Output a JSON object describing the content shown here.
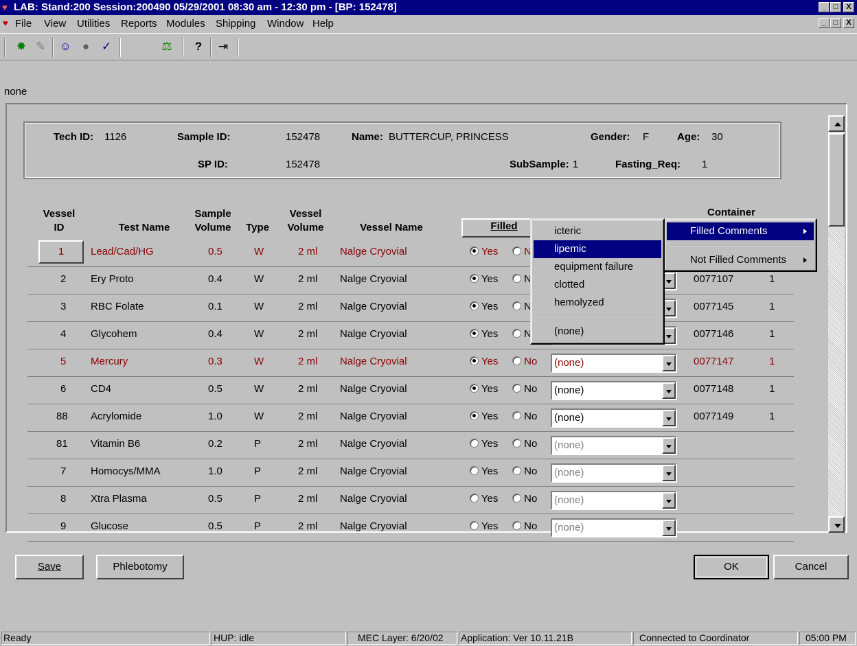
{
  "window": {
    "title": "LAB: Stand:200 Session:200490 05/29/2001 08:30 am - 12:30 pm - [BP: 152478]",
    "controls": [
      "_",
      "□",
      "X"
    ]
  },
  "menubar": {
    "items": [
      {
        "label": "File"
      },
      {
        "label": "View"
      },
      {
        "label": "Utilities"
      },
      {
        "label": "Reports"
      },
      {
        "label": "Modules"
      },
      {
        "label": "Shipping"
      },
      {
        "label": "Window"
      },
      {
        "label": "Help"
      }
    ]
  },
  "toolbar": {
    "icons": [
      "new-icon",
      "edit-icon",
      "people-icon",
      "record-icon",
      "checkmark-icon",
      "scale-icon",
      "help-icon",
      "exit-icon"
    ],
    "glyphs": [
      "✸",
      "✎",
      "☺",
      "●",
      "✓",
      "⚖",
      "?",
      "⇥"
    ]
  },
  "status_line": "none",
  "info": {
    "tech_id_label": "Tech ID:",
    "tech_id": "1126",
    "sample_id_label": "Sample ID:",
    "sample_id": "152478",
    "name_label": "Name:",
    "name": "BUTTERCUP, PRINCESS",
    "gender_label": "Gender:",
    "gender": "F",
    "age_label": "Age:",
    "age": "30",
    "sp_id_label": "SP ID:",
    "sp_id": "152478",
    "subsample_label": "SubSample:",
    "subsample": "1",
    "fasting_label": "Fasting_Req:",
    "fasting": "1"
  },
  "table": {
    "headers": {
      "vessel_id": "Vessel\nID",
      "test_name": "Test Name",
      "sample_volume": "Sample\nVolume",
      "type": "Type",
      "vessel_volume": "Vessel\nVolume",
      "vessel_name": "Vessel Name",
      "filled": "Filled",
      "container": "Container"
    },
    "rows": [
      {
        "id": "1",
        "test": "Lead/Cad/HG",
        "sv": "0.5",
        "type": "W",
        "vv": "2 ml",
        "vessel": "Nalge Cryovial",
        "yes": "Yes",
        "no": "No",
        "filled": "yes",
        "comment": "(none)",
        "container": "",
        "qty": "",
        "highlight": true,
        "enabled": true
      },
      {
        "id": "2",
        "test": "Ery Proto",
        "sv": "0.4",
        "type": "W",
        "vv": "2 ml",
        "vessel": "Nalge Cryovial",
        "yes": "Yes",
        "no": "No",
        "filled": "yes",
        "comment": "(none)",
        "container": "0077107",
        "qty": "1",
        "highlight": false,
        "enabled": true
      },
      {
        "id": "3",
        "test": "RBC Folate",
        "sv": "0.1",
        "type": "W",
        "vv": "2 ml",
        "vessel": "Nalge Cryovial",
        "yes": "Yes",
        "no": "No",
        "filled": "yes",
        "comment": "(none)",
        "container": "0077145",
        "qty": "1",
        "highlight": false,
        "enabled": true
      },
      {
        "id": "4",
        "test": "Glycohem",
        "sv": "0.4",
        "type": "W",
        "vv": "2 ml",
        "vessel": "Nalge Cryovial",
        "yes": "Yes",
        "no": "No",
        "filled": "yes",
        "comment": "(none)",
        "container": "0077146",
        "qty": "1",
        "highlight": false,
        "enabled": true
      },
      {
        "id": "5",
        "test": "Mercury",
        "sv": "0.3",
        "type": "W",
        "vv": "2 ml",
        "vessel": "Nalge Cryovial",
        "yes": "Yes",
        "no": "No",
        "filled": "yes",
        "comment": "(none)",
        "container": "0077147",
        "qty": "1",
        "highlight": true,
        "enabled": true
      },
      {
        "id": "6",
        "test": "CD4",
        "sv": "0.5",
        "type": "W",
        "vv": "2 ml",
        "vessel": "Nalge Cryovial",
        "yes": "Yes",
        "no": "No",
        "filled": "yes",
        "comment": "(none)",
        "container": "0077148",
        "qty": "1",
        "highlight": false,
        "enabled": true
      },
      {
        "id": "88",
        "test": "Acrylomide",
        "sv": "1.0",
        "type": "W",
        "vv": "2 ml",
        "vessel": "Nalge Cryovial",
        "yes": "Yes",
        "no": "No",
        "filled": "yes",
        "comment": "(none)",
        "container": "0077149",
        "qty": "1",
        "highlight": false,
        "enabled": true
      },
      {
        "id": "81",
        "test": "Vitamin B6",
        "sv": "0.2",
        "type": "P",
        "vv": "2 ml",
        "vessel": "Nalge Cryovial",
        "yes": "Yes",
        "no": "No",
        "filled": "none",
        "comment": "(none)",
        "container": "",
        "qty": "",
        "highlight": false,
        "enabled": false
      },
      {
        "id": "7",
        "test": "Homocys/MMA",
        "sv": "1.0",
        "type": "P",
        "vv": "2 ml",
        "vessel": "Nalge Cryovial",
        "yes": "Yes",
        "no": "No",
        "filled": "none",
        "comment": "(none)",
        "container": "",
        "qty": "",
        "highlight": false,
        "enabled": false
      },
      {
        "id": "8",
        "test": "Xtra Plasma",
        "sv": "0.5",
        "type": "P",
        "vv": "2 ml",
        "vessel": "Nalge Cryovial",
        "yes": "Yes",
        "no": "No",
        "filled": "none",
        "comment": "(none)",
        "container": "",
        "qty": "",
        "highlight": false,
        "enabled": false
      },
      {
        "id": "9",
        "test": "Glucose",
        "sv": "0.5",
        "type": "P",
        "vv": "2 ml",
        "vessel": "Nalge Cryovial",
        "yes": "Yes",
        "no": "No",
        "filled": "none",
        "comment": "(none)",
        "container": "",
        "qty": "",
        "highlight": false,
        "enabled": false
      }
    ]
  },
  "context_menu": {
    "items": [
      {
        "label": "Filled Comments",
        "selected": true
      },
      {
        "label": "Not Filled Comments",
        "selected": false
      }
    ]
  },
  "submenu": {
    "items": [
      {
        "label": "icteric",
        "selected": false
      },
      {
        "label": "lipemic",
        "selected": true
      },
      {
        "label": "equipment failure",
        "selected": false
      },
      {
        "label": "clotted",
        "selected": false
      },
      {
        "label": "hemolyzed",
        "selected": false
      },
      {
        "label": "(none)",
        "selected": false
      }
    ]
  },
  "buttons": {
    "save": "Save",
    "phlebotomy": "Phlebotomy",
    "ok": "OK",
    "cancel": "Cancel"
  },
  "statusbar": {
    "ready": "Ready",
    "hup": "HUP: idle",
    "mec": "MEC Layer: 6/20/02",
    "app": "Application: Ver 10.11.21B",
    "connection": "Connected to Coordinator",
    "time": "05:00 PM"
  },
  "colors": {
    "title_bar": "#000080",
    "highlight_text": "#8b0000",
    "selection": "#000080"
  }
}
